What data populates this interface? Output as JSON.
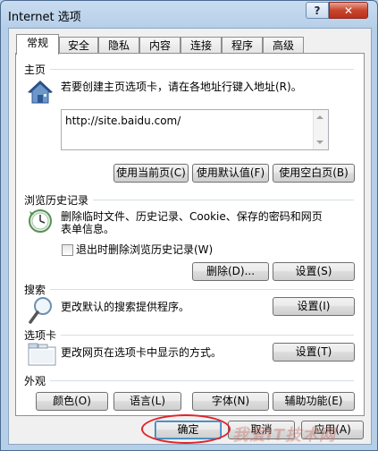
{
  "window": {
    "title": "Internet 选项",
    "help_label": "?",
    "close_label": "✕"
  },
  "tabs": [
    "常规",
    "安全",
    "隐私",
    "内容",
    "连接",
    "程序",
    "高级"
  ],
  "home": {
    "heading": "主页",
    "description": "若要创建主页选项卡，请在各地址行键入地址(R)。",
    "url": "http://site.baidu.com/",
    "buttons": [
      "使用当前页(C)",
      "使用默认值(F)",
      "使用空白页(B)"
    ]
  },
  "history": {
    "heading": "浏览历史记录",
    "description_line1": "删除临时文件、历史记录、Cookie、保存的密码和网页",
    "description_line2": "表单信息。",
    "checkbox_label": "退出时删除浏览历史记录(W)",
    "checkbox_checked": false,
    "delete_label": "删除(D)...",
    "settings_label": "设置(S)"
  },
  "search": {
    "heading": "搜索",
    "description": "更改默认的搜索提供程序。",
    "settings_label": "设置(I)"
  },
  "tabs_section": {
    "heading": "选项卡",
    "description": "更改网页在选项卡中显示的方式。",
    "settings_label": "设置(T)"
  },
  "appearance": {
    "heading": "外观",
    "buttons": [
      "颜色(O)",
      "语言(L)",
      "字体(N)",
      "辅助功能(E)"
    ]
  },
  "footer": {
    "ok_label": "确定",
    "cancel_label": "取消",
    "apply_label": "应用(A)"
  },
  "watermark": "我爱IT技术网"
}
